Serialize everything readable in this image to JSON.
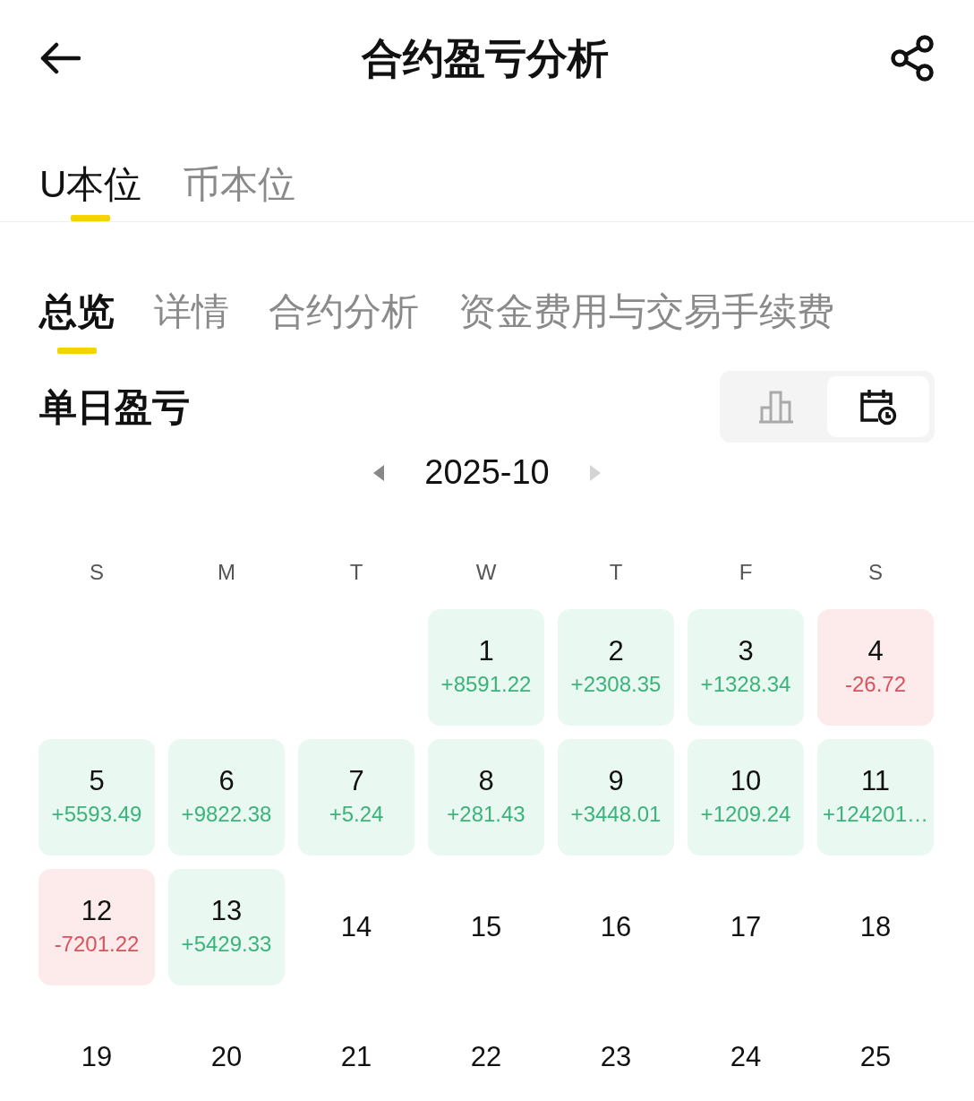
{
  "header": {
    "title": "合约盈亏分析"
  },
  "account_tabs": [
    {
      "label": "U本位",
      "selected": true
    },
    {
      "label": "币本位",
      "selected": false
    }
  ],
  "sub_tabs": [
    {
      "label": "总览",
      "selected": true
    },
    {
      "label": "详情",
      "selected": false
    },
    {
      "label": "合约分析",
      "selected": false
    },
    {
      "label": "资金费用与交易手续费",
      "selected": false
    }
  ],
  "section": {
    "title": "单日盈亏",
    "views": [
      {
        "kind": "chart",
        "selected": false
      },
      {
        "kind": "calendar",
        "selected": true
      }
    ]
  },
  "month": "2025-10",
  "weekdays": [
    "S",
    "M",
    "T",
    "W",
    "T",
    "F",
    "S"
  ],
  "days": [
    {
      "kind": "empty"
    },
    {
      "kind": "empty"
    },
    {
      "kind": "empty"
    },
    {
      "kind": "profit",
      "day": "1",
      "pnl": "+8591.22"
    },
    {
      "kind": "profit",
      "day": "2",
      "pnl": "+2308.35"
    },
    {
      "kind": "profit",
      "day": "3",
      "pnl": "+1328.34"
    },
    {
      "kind": "loss",
      "day": "4",
      "pnl": "-26.72"
    },
    {
      "kind": "profit",
      "day": "5",
      "pnl": "+5593.49"
    },
    {
      "kind": "profit",
      "day": "6",
      "pnl": "+9822.38"
    },
    {
      "kind": "profit",
      "day": "7",
      "pnl": "+5.24"
    },
    {
      "kind": "profit",
      "day": "8",
      "pnl": "+281.43"
    },
    {
      "kind": "profit",
      "day": "9",
      "pnl": "+3448.01"
    },
    {
      "kind": "profit",
      "day": "10",
      "pnl": "+1209.24"
    },
    {
      "kind": "profit",
      "day": "11",
      "pnl": "+124201…"
    },
    {
      "kind": "loss",
      "day": "12",
      "pnl": "-7201.22"
    },
    {
      "kind": "profit",
      "day": "13",
      "pnl": "+5429.33"
    },
    {
      "kind": "plain",
      "day": "14"
    },
    {
      "kind": "plain",
      "day": "15"
    },
    {
      "kind": "plain",
      "day": "16"
    },
    {
      "kind": "plain",
      "day": "17"
    },
    {
      "kind": "plain",
      "day": "18"
    },
    {
      "kind": "plain",
      "day": "19"
    },
    {
      "kind": "plain",
      "day": "20"
    },
    {
      "kind": "plain",
      "day": "21"
    },
    {
      "kind": "plain",
      "day": "22"
    },
    {
      "kind": "plain",
      "day": "23"
    },
    {
      "kind": "plain",
      "day": "24"
    },
    {
      "kind": "plain",
      "day": "25"
    }
  ]
}
